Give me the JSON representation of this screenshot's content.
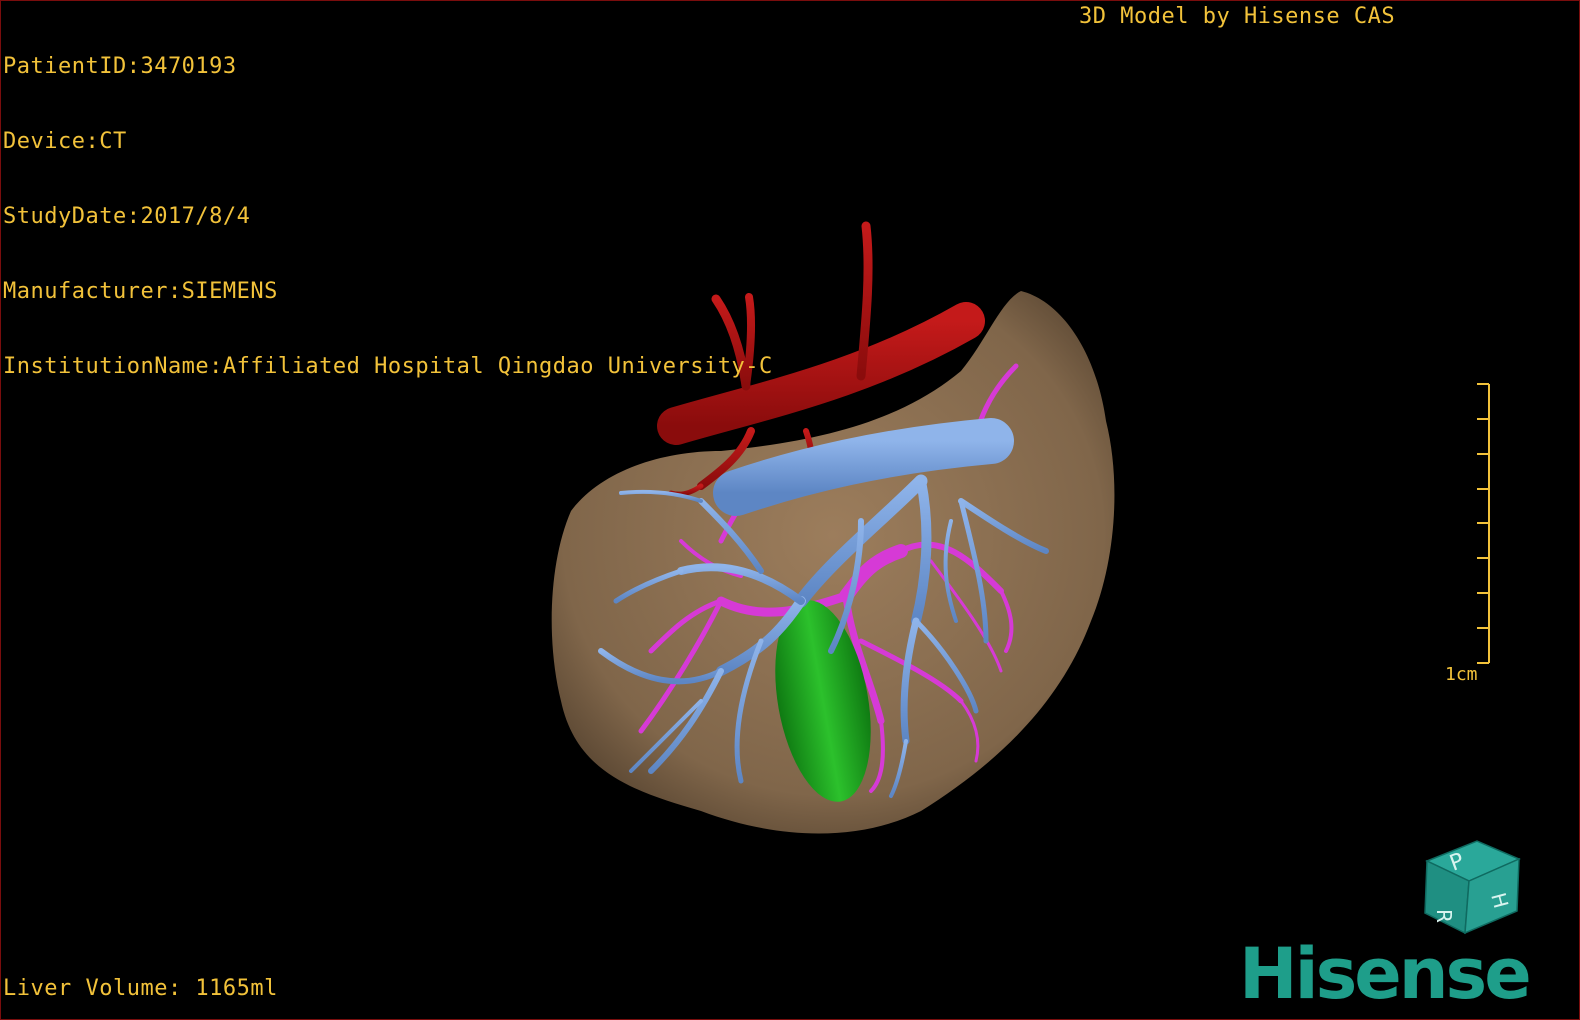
{
  "patient_info": {
    "patient_id": "PatientID:3470193",
    "device": "Device:CT",
    "study_date": "StudyDate:2017/8/4",
    "manufacturer": "Manufacturer:SIEMENS",
    "institution": "InstitutionName:Affiliated Hospital Qingdao University-C"
  },
  "model_credit": "3D Model by Hisense CAS",
  "liver_volume": "Liver Volume: 1165ml",
  "scale_bar": {
    "label": "1cm"
  },
  "orientation_cube": {
    "faces": [
      "P",
      "H",
      "R"
    ]
  },
  "brand": {
    "logo": "Hisense"
  },
  "colors": {
    "overlay_text": "#f2c23a",
    "liver": "#8c7052",
    "artery": "#b01010",
    "portal_vein": "#6f9ad6",
    "hepatic_vein": "#d63ad6",
    "gallbladder": "#1e9a1e",
    "brand": "#1e9e8a"
  }
}
